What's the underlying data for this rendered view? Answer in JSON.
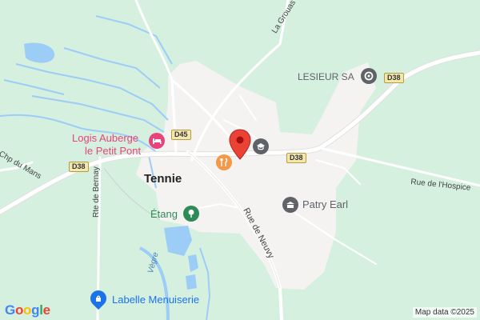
{
  "map": {
    "place_label": "Tennie",
    "attribution": "Map data ©2025",
    "logo": "Google"
  },
  "pois": [
    {
      "name": "lesieur",
      "label": "LESIEUR SA",
      "icon": "location-icon",
      "color": "#5f6368"
    },
    {
      "name": "logis-auberge",
      "label_line1": "Logis Auberge",
      "label_line2": "le Petit Pont",
      "icon": "hotel-icon",
      "color": "#e8437b"
    },
    {
      "name": "patry-earl",
      "label": "Patry Earl",
      "icon": "hotel-icon",
      "color": "#5f6368"
    },
    {
      "name": "etang",
      "label": "Étang",
      "icon": "park-icon",
      "color": "#2e8b57"
    },
    {
      "name": "labelle-menuiserie",
      "label": "Labelle Menuiserie",
      "icon": "shopping-icon",
      "color": "#1a73e8"
    },
    {
      "name": "restaurant",
      "icon": "restaurant-icon",
      "color": "#f2994a"
    },
    {
      "name": "school",
      "icon": "school-icon",
      "color": "#5f6368"
    }
  ],
  "roads": {
    "d45": "D45",
    "d38_left": "D38",
    "d38_mid": "D38",
    "d38_right": "D38",
    "la_grouas": "La Grouas",
    "chp_du_mans": "Chp du Mans",
    "rte_de_bernay": "Rte de Bernay",
    "rue_de_neuvy": "Rue de Neuvy",
    "rue_de_l_hospice": "Rue de l'Hospice",
    "vegre": "Vègre"
  },
  "marker": {
    "icon": "red-pin-icon",
    "color": "#ea4335"
  }
}
